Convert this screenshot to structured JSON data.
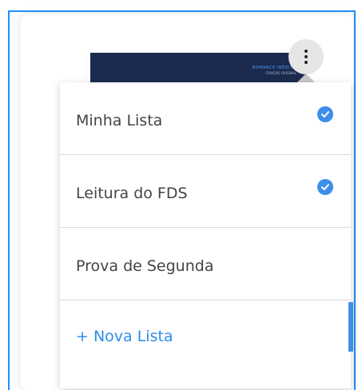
{
  "book": {
    "title_line": "ROMANCE INÉDITO",
    "subtitle_line": "CRIAÇÃO ORIGINAL"
  },
  "menu": {
    "button_icon": "more-vertical-icon"
  },
  "lists": [
    {
      "label": "Minha Lista",
      "checked": true
    },
    {
      "label": "Leitura do FDS",
      "checked": true
    },
    {
      "label": "Prova de Segunda",
      "checked": false
    }
  ],
  "add_list": {
    "label": "+ Nova Lista"
  },
  "colors": {
    "accent": "#3d8ee8",
    "frame": "#1e90ff",
    "book_cover": "#1b2a4e"
  }
}
